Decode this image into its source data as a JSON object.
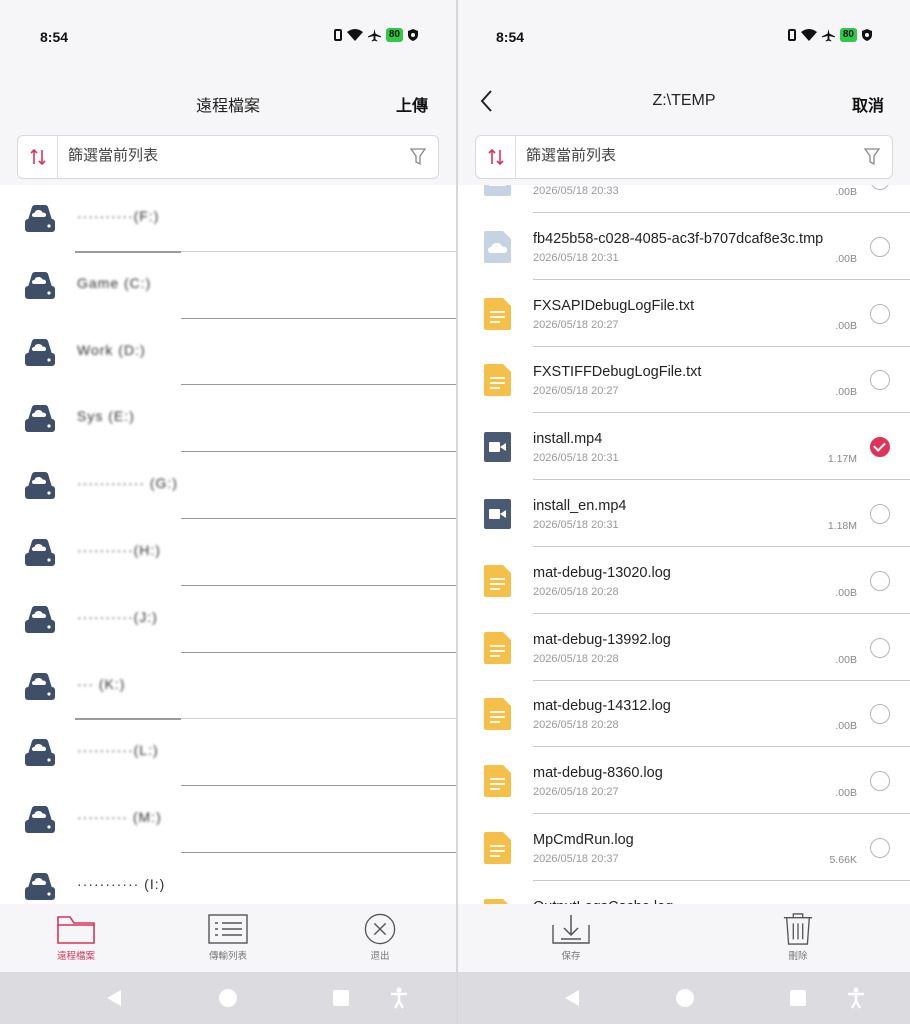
{
  "status": {
    "time": "8:54",
    "battery": "80"
  },
  "left": {
    "title": "遠程檔案",
    "action": "上傳",
    "search_placeholder": "篩選當前列表",
    "drives": [
      {
        "label": "··········(F:)"
      },
      {
        "label": "Game (C:)"
      },
      {
        "label": "Work (D:)"
      },
      {
        "label": "Sys (E:)"
      },
      {
        "label": "············ (G:)"
      },
      {
        "label": "··········(H:)"
      },
      {
        "label": "··········(J:)"
      },
      {
        "label": "··· (K:)"
      },
      {
        "label": "··········(L:)"
      },
      {
        "label": "········· (M:)"
      },
      {
        "label": "··········· (I:)"
      }
    ],
    "tabs": [
      {
        "label": "遠程檔案"
      },
      {
        "label": "傳輸列表"
      },
      {
        "label": "退出"
      }
    ]
  },
  "right": {
    "title": "Z:\\TEMP",
    "action": "取消",
    "search_placeholder": "篩選當前列表",
    "files": [
      {
        "name": "",
        "date": "2026/05/18 20:33",
        "size": ".00B",
        "type": "cloud",
        "checked": false
      },
      {
        "name": "fb425b58-c028-4085-ac3f-b707dcaf8e3c.tmp",
        "date": "2026/05/18 20:31",
        "size": ".00B",
        "type": "cloud",
        "checked": false
      },
      {
        "name": "FXSAPIDebugLogFile.txt",
        "date": "2026/05/18 20:27",
        "size": ".00B",
        "type": "doc",
        "checked": false
      },
      {
        "name": "FXSTIFFDebugLogFile.txt",
        "date": "2026/05/18 20:27",
        "size": ".00B",
        "type": "doc",
        "checked": false
      },
      {
        "name": "install.mp4",
        "date": "2026/05/18 20:31",
        "size": "1.17M",
        "type": "video",
        "checked": true
      },
      {
        "name": "install_en.mp4",
        "date": "2026/05/18 20:31",
        "size": "1.18M",
        "type": "video",
        "checked": false
      },
      {
        "name": "mat-debug-13020.log",
        "date": "2026/05/18 20:28",
        "size": ".00B",
        "type": "doc",
        "checked": false
      },
      {
        "name": "mat-debug-13992.log",
        "date": "2026/05/18 20:28",
        "size": ".00B",
        "type": "doc",
        "checked": false
      },
      {
        "name": "mat-debug-14312.log",
        "date": "2026/05/18 20:28",
        "size": ".00B",
        "type": "doc",
        "checked": false
      },
      {
        "name": "mat-debug-8360.log",
        "date": "2026/05/18 20:27",
        "size": ".00B",
        "type": "doc",
        "checked": false
      },
      {
        "name": "MpCmdRun.log",
        "date": "2026/05/18 20:37",
        "size": "5.66K",
        "type": "doc",
        "checked": false
      },
      {
        "name": "OutputLogsCache.log",
        "date": "",
        "size": "",
        "type": "doc",
        "checked": false
      }
    ],
    "tabs": [
      {
        "label": "保存"
      },
      {
        "label": "刪除"
      }
    ]
  },
  "colors": {
    "accent": "#e0335a",
    "doc": "#f5c04a",
    "cloud": "#c5d3e2",
    "video": "#4a5a72",
    "drive": "#3f4f67"
  }
}
